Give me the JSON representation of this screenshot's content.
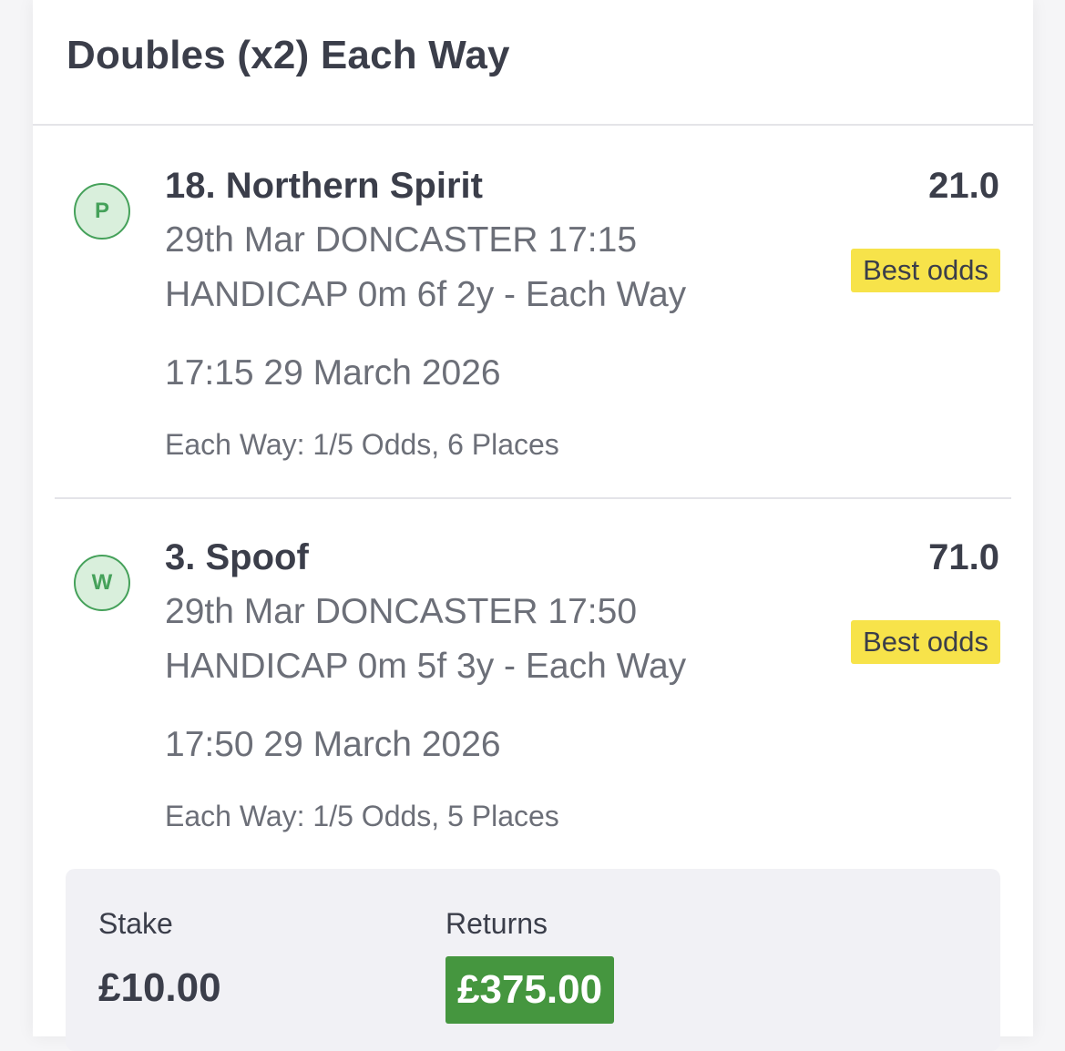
{
  "bet": {
    "title": "Doubles (x2) Each Way"
  },
  "selections": [
    {
      "result": "P",
      "name": "18. Northern Spirit",
      "odds": "21.0",
      "badge": "Best odds",
      "race_line1": "29th Mar DONCASTER 17:15",
      "race_line2": "HANDICAP 0m 6f 2y - Each Way",
      "time": "17:15 29 March 2026",
      "ew_terms": "Each Way: 1/5 Odds, 6 Places"
    },
    {
      "result": "W",
      "name": "3. Spoof",
      "odds": "71.0",
      "badge": "Best odds",
      "race_line1": "29th Mar DONCASTER 17:50",
      "race_line2": "HANDICAP 0m 5f 3y - Each Way",
      "time": "17:50 29 March 2026",
      "ew_terms": "Each Way: 1/5 Odds, 5 Places"
    }
  ],
  "summary": {
    "stake_label": "Stake",
    "stake_value": "£10.00",
    "returns_label": "Returns",
    "returns_value": "£375.00"
  },
  "colors": {
    "win_place_green": "#45a15a",
    "best_odds_yellow": "#f7e34a",
    "returns_green": "#45963f"
  }
}
